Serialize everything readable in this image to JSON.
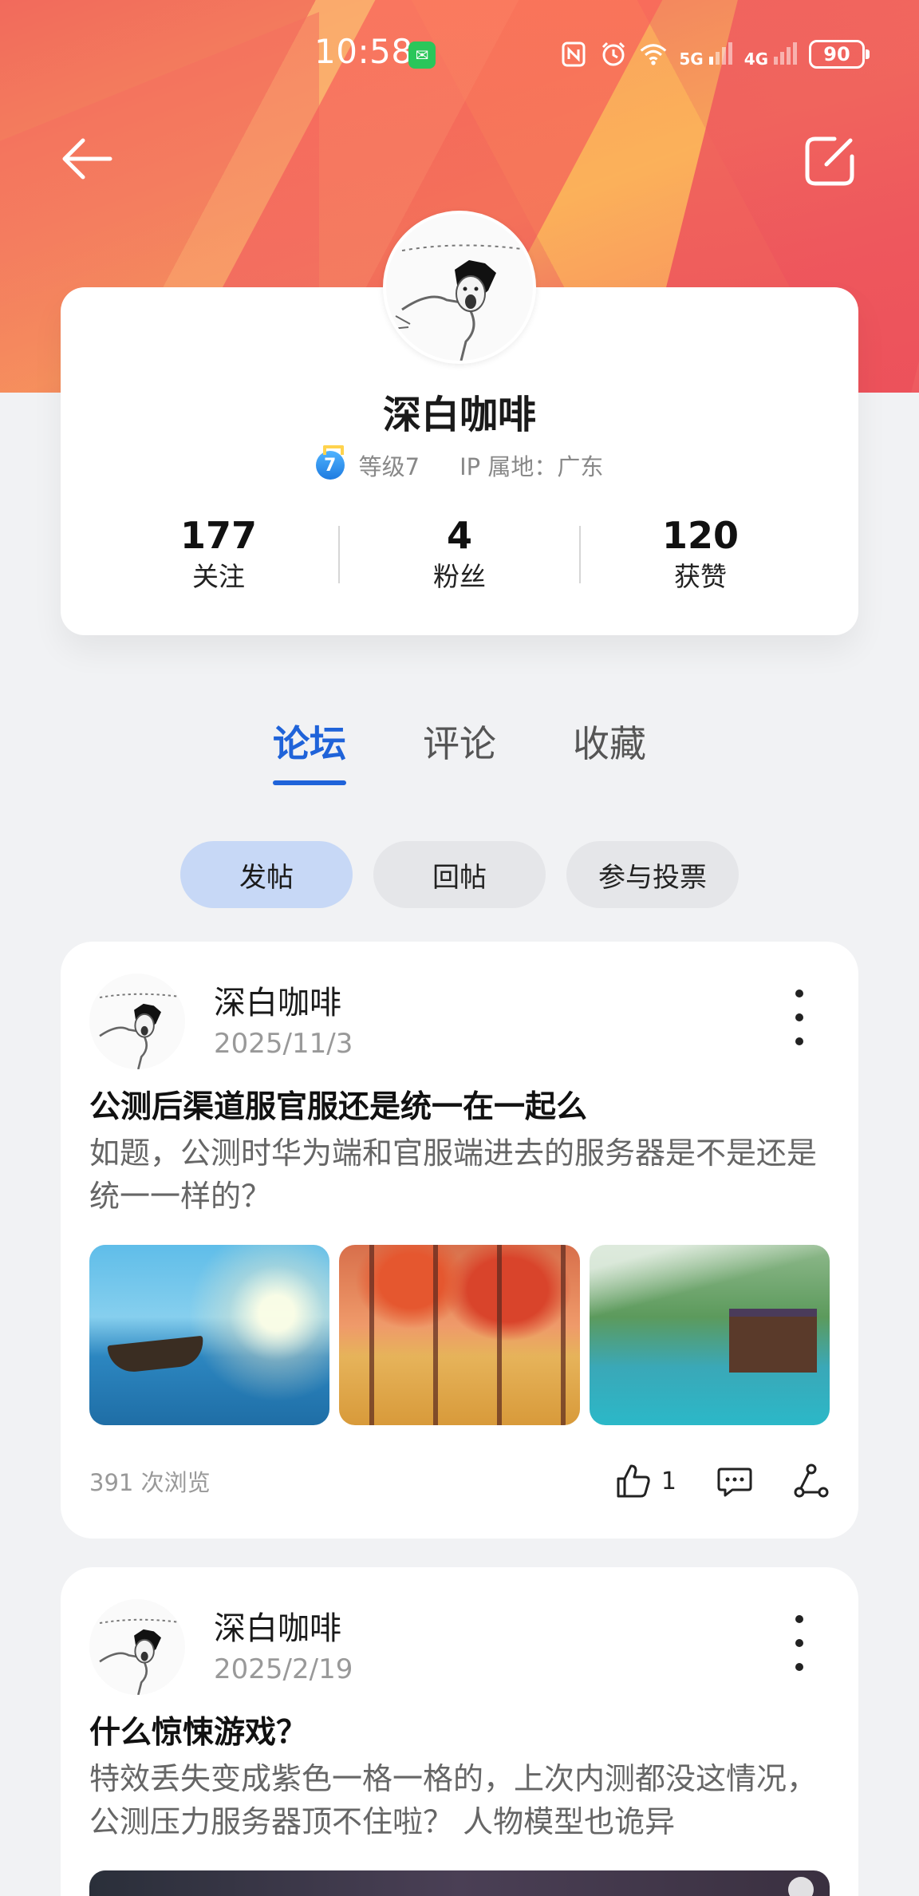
{
  "status_bar": {
    "time": "10:58",
    "network_5g": "5G",
    "network_4g": "4G",
    "battery": "90"
  },
  "nav": {
    "back_icon": "arrow-left-icon",
    "edit_icon": "edit-icon"
  },
  "profile": {
    "name": "深白咖啡",
    "level_number": "7",
    "level_text": "等级7",
    "ip_location": "IP 属地：广东",
    "stats": [
      {
        "value": "177",
        "label": "关注"
      },
      {
        "value": "4",
        "label": "粉丝"
      },
      {
        "value": "120",
        "label": "获赞"
      }
    ]
  },
  "tabs": [
    {
      "label": "论坛",
      "active": true
    },
    {
      "label": "评论",
      "active": false
    },
    {
      "label": "收藏",
      "active": false
    }
  ],
  "chips": [
    {
      "label": "发帖",
      "active": true
    },
    {
      "label": "回帖",
      "active": false
    },
    {
      "label": "参与投票",
      "active": false
    }
  ],
  "posts": [
    {
      "author": "深白咖啡",
      "date": "2025/11/3",
      "title": "公测后渠道服官服还是统一在一起么",
      "body": "如题，公测时华为端和官服端进去的服务器是不是还是统一一样的？",
      "views": "391 次浏览",
      "likes": "1"
    },
    {
      "author": "深白咖啡",
      "date": "2025/2/19",
      "title": "什么惊悚游戏？",
      "body": "特效丢失变成紫色一格一格的，上次内测都没这情况，公测压力服务器顶不住啦？ 人物模型也诡异"
    }
  ],
  "colors": {
    "accent": "#1f63d9",
    "chip_active": "#c7d8f6",
    "banner_primary": "#f26a5c"
  }
}
